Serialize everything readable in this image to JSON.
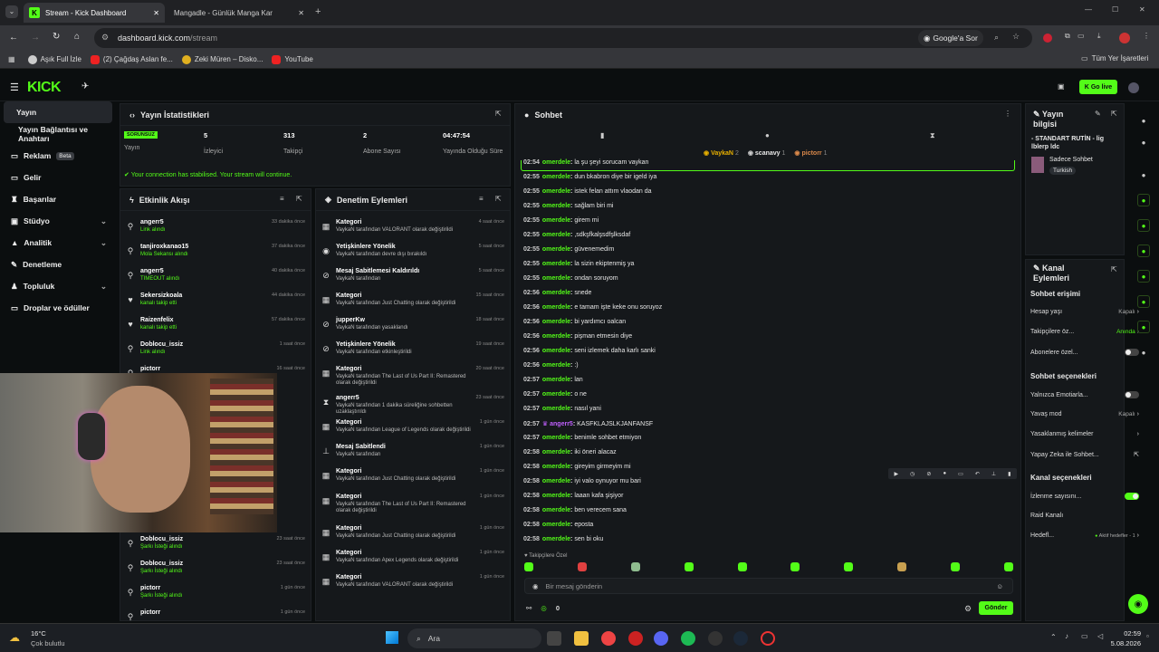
{
  "browser": {
    "tabs": [
      {
        "title": "Stream - Kick Dashboard",
        "active": true
      },
      {
        "title": "Mangadle - Günlük Manga Kar",
        "active": false
      }
    ],
    "url_host": "dashboard.kick.com",
    "url_path": "/stream",
    "google_btn": "Google'a Sor",
    "bookmarks": [
      "Aşık Full İzle",
      "(2) Çağdaş Aslan fe...",
      "Zeki Müren – Disko...",
      "YouTube"
    ],
    "all_bookmarks": "Tüm Yer İşaretleri"
  },
  "header": {
    "logo": "KICK",
    "go_live": "Go live"
  },
  "sidebar": {
    "items": [
      {
        "label": "Yayın",
        "active": true
      },
      {
        "label": "Yayın Bağlantısı ve Anahtarı"
      },
      {
        "label": "Reklam",
        "badge": "Beta"
      },
      {
        "label": "Gelir"
      },
      {
        "label": "Başarılar"
      },
      {
        "label": "Stüdyo",
        "chev": true
      },
      {
        "label": "Analitik",
        "chev": true
      },
      {
        "label": "Denetleme"
      },
      {
        "label": "Topluluk",
        "chev": true
      },
      {
        "label": "Droplar ve ödüller"
      }
    ]
  },
  "stats": {
    "title": "Yayın İstatistikleri",
    "status_badge": "SORUNSUZ",
    "status_label": "Yayın",
    "items": [
      {
        "v": "5",
        "l": "İzleyici"
      },
      {
        "v": "313",
        "l": "Takipçi"
      },
      {
        "v": "2",
        "l": "Abone Sayısı"
      },
      {
        "v": "04:47:54",
        "l": "Yayında Olduğu Süre"
      }
    ],
    "notice": "Your connection has stabilised. Your stream will continue."
  },
  "activity": {
    "title": "Etkinlik Akışı",
    "rows": [
      {
        "name": "angerr5",
        "sub": "Link alındı",
        "time": "33 dakika önce"
      },
      {
        "name": "tanjiroxkanao15",
        "sub": "Mola Sekansı alındı",
        "time": "37 dakika önce"
      },
      {
        "name": "angerr5",
        "sub": "TIMEOUT alındı",
        "time": "40 dakika önce"
      },
      {
        "name": "Sekersizkoala",
        "sub": "kanalı takip etti",
        "time": "44 dakika önce"
      },
      {
        "name": "Raizenfelix",
        "sub": "kanalı takip etti",
        "time": "57 dakika önce"
      },
      {
        "name": "Doblocu_issiz",
        "sub": "Link alındı",
        "time": "1 saat önce"
      },
      {
        "name": "pictorr",
        "sub": "",
        "time": "16 saat önce"
      },
      {
        "name": "Doblocu_issiz",
        "sub": "Şarkı İsteği alındı",
        "time": "23 saat önce"
      },
      {
        "name": "Doblocu_issiz",
        "sub": "Şarkı İsteği alındı",
        "time": "23 saat önce"
      },
      {
        "name": "pictorr",
        "sub": "Şarkı İsteği alındı",
        "time": "1 gün önce"
      },
      {
        "name": "pictorr",
        "sub": "",
        "time": "1 gün önce"
      }
    ]
  },
  "moderation": {
    "title": "Denetim Eylemleri",
    "rows": [
      {
        "name": "Kategori",
        "sub": "VaykaN tarafından VALORANT olarak değiştirildi",
        "time": "4 saat önce"
      },
      {
        "name": "Yetişkinlere Yönelik",
        "sub": "VaykaN tarafından devre dışı bırakıldı",
        "time": "5 saat önce"
      },
      {
        "name": "Mesaj Sabitlemesi Kaldırıldı",
        "sub": "VaykaN tarafından",
        "time": "5 saat önce"
      },
      {
        "name": "Kategori",
        "sub": "VaykaN tarafından Just Chatting olarak değiştirildi",
        "time": "15 saat önce"
      },
      {
        "name": "jupperKw",
        "sub": "VaykaN tarafından yasaklandı",
        "time": "18 saat önce"
      },
      {
        "name": "Yetişkinlere Yönelik",
        "sub": "VaykaN tarafından etkinleştirildi",
        "time": "19 saat önce"
      },
      {
        "name": "Kategori",
        "sub": "VaykaN tarafından The Last of Us Part II: Remastered olarak değiştirildi",
        "time": "20 saat önce"
      },
      {
        "name": "angerr5",
        "sub": "VaykaN tarafından 1 dakika süreliğine sohbetten uzaklaştırıldı",
        "time": "23 saat önce"
      },
      {
        "name": "Kategori",
        "sub": "VaykaN tarafından League of Legends olarak değiştirildi",
        "time": "1 gün önce"
      },
      {
        "name": "Mesaj Sabitlendi",
        "sub": "VaykaN tarafından",
        "time": "1 gün önce"
      },
      {
        "name": "Kategori",
        "sub": "VaykaN tarafından Just Chatting olarak değiştirildi",
        "time": "1 gün önce"
      },
      {
        "name": "Kategori",
        "sub": "VaykaN tarafından The Last of Us Part II: Remastered olarak değiştirildi",
        "time": "1 gün önce"
      },
      {
        "name": "Kategori",
        "sub": "VaykaN tarafından Just Chatting olarak değiştirildi",
        "time": "1 gün önce"
      },
      {
        "name": "Kategori",
        "sub": "VaykaN tarafından Apex Legends olarak değiştirildi",
        "time": "1 gün önce"
      },
      {
        "name": "Kategori",
        "sub": "VaykaN tarafından VALORANT olarak değiştirildi",
        "time": "1 gün önce"
      }
    ]
  },
  "chat": {
    "title": "Sohbet",
    "top_users": [
      {
        "name": "VaykaN",
        "n": "2"
      },
      {
        "name": "scanavy",
        "n": "1"
      },
      {
        "name": "pictorr",
        "n": "1"
      }
    ],
    "messages": [
      {
        "t": "02:54",
        "u": "omerdele",
        "m": "la şu şeyi sorucam vaykan"
      },
      {
        "t": "02:55",
        "u": "omerdele",
        "m": "dun bkabron diye bir igeld iya"
      },
      {
        "t": "02:55",
        "u": "omerdele",
        "m": "istek felan attım vlaodan da"
      },
      {
        "t": "02:55",
        "u": "omerdele",
        "m": "sağlam biri mi"
      },
      {
        "t": "02:55",
        "u": "omerdele",
        "m": "girem mi"
      },
      {
        "t": "02:55",
        "u": "omerdele",
        "m": ",sdkşfkalşsdfşlksdaf"
      },
      {
        "t": "02:55",
        "u": "omerdele",
        "m": "güvenemedim"
      },
      {
        "t": "02:55",
        "u": "omerdele",
        "m": "la sizin ekiptenmiş ya"
      },
      {
        "t": "02:55",
        "u": "omerdele",
        "m": "ondan soruyom"
      },
      {
        "t": "02:56",
        "u": "omerdele",
        "m": "snede"
      },
      {
        "t": "02:56",
        "u": "omerdele",
        "m": "e tamam işte keke onu soruyoz"
      },
      {
        "t": "02:56",
        "u": "omerdele",
        "m": "bi yardımcı oalcan"
      },
      {
        "t": "02:56",
        "u": "omerdele",
        "m": "pişman etmesin diye"
      },
      {
        "t": "02:56",
        "u": "omerdele",
        "m": "seni izlemek daha karlı sanki"
      },
      {
        "t": "02:56",
        "u": "omerdele",
        "m": ":)"
      },
      {
        "t": "02:57",
        "u": "omerdele",
        "m": "lan"
      },
      {
        "t": "02:57",
        "u": "omerdele",
        "m": "o ne"
      },
      {
        "t": "02:57",
        "u": "omerdele",
        "m": "nasıl yani"
      },
      {
        "t": "02:57",
        "u": "angerr5",
        "m": "KASFKLAJSLKJANFANSF",
        "purple": true
      },
      {
        "t": "02:57",
        "u": "omerdele",
        "m": "benimle sohbet etmiyon"
      },
      {
        "t": "02:58",
        "u": "omerdele",
        "m": "iki öneri alacaz"
      },
      {
        "t": "02:58",
        "u": "omerdele",
        "m": "gireyim girmeyim mi"
      },
      {
        "t": "02:58",
        "u": "omerdele",
        "m": "iyi valo oynuyor mu bari"
      },
      {
        "t": "02:58",
        "u": "omerdele",
        "m": "laaan kafa şişiyor"
      },
      {
        "t": "02:58",
        "u": "omerdele",
        "m": "ben verecem sana"
      },
      {
        "t": "02:58",
        "u": "omerdele",
        "m": "eposta"
      },
      {
        "t": "02:58",
        "u": "omerdele",
        "m": "sen bi oku"
      }
    ],
    "followers_only": "Takipçilere Özel",
    "input_placeholder": "Bir mesaj gönderin",
    "points": "0",
    "send": "Gönder"
  },
  "stream_info": {
    "title": "Yayın bilgisi",
    "stream_title": "- STANDART RUTİN - lig lblerp ldc",
    "category": "Sadece Sohbet",
    "tag": "Turkish"
  },
  "channel_actions": {
    "title": "Kanal Eylemleri",
    "chat_access": "Sohbet erişimi",
    "account_age": {
      "l": "Hesap yaşı",
      "v": "Kapalı"
    },
    "followers_only": {
      "l": "Takipçilere öz...",
      "v": "Anında"
    },
    "subs_only": "Abonelere özel...",
    "chat_options": "Sohbet seçenekleri",
    "emotes_only": "Yalnızca Emotiarla...",
    "slow_mode": {
      "l": "Yavaş mod",
      "v": "Kapalı"
    },
    "banned_words": "Yasaklanmış kelimeler",
    "ai_chat": "Yapay Zeka ile Sohbet...",
    "channel_options": "Kanal seçenekleri",
    "viewer_count": "İzlenme sayısını...",
    "raid": "Raid Kanalı",
    "goals": {
      "l": "Hedefl...",
      "v": "Aktif hedefler - 1"
    }
  },
  "taskbar": {
    "weather_temp": "16°C",
    "weather_desc": "Çok bulutlu",
    "search": "Ara",
    "time": "02:59",
    "date": "5.08.2026"
  }
}
